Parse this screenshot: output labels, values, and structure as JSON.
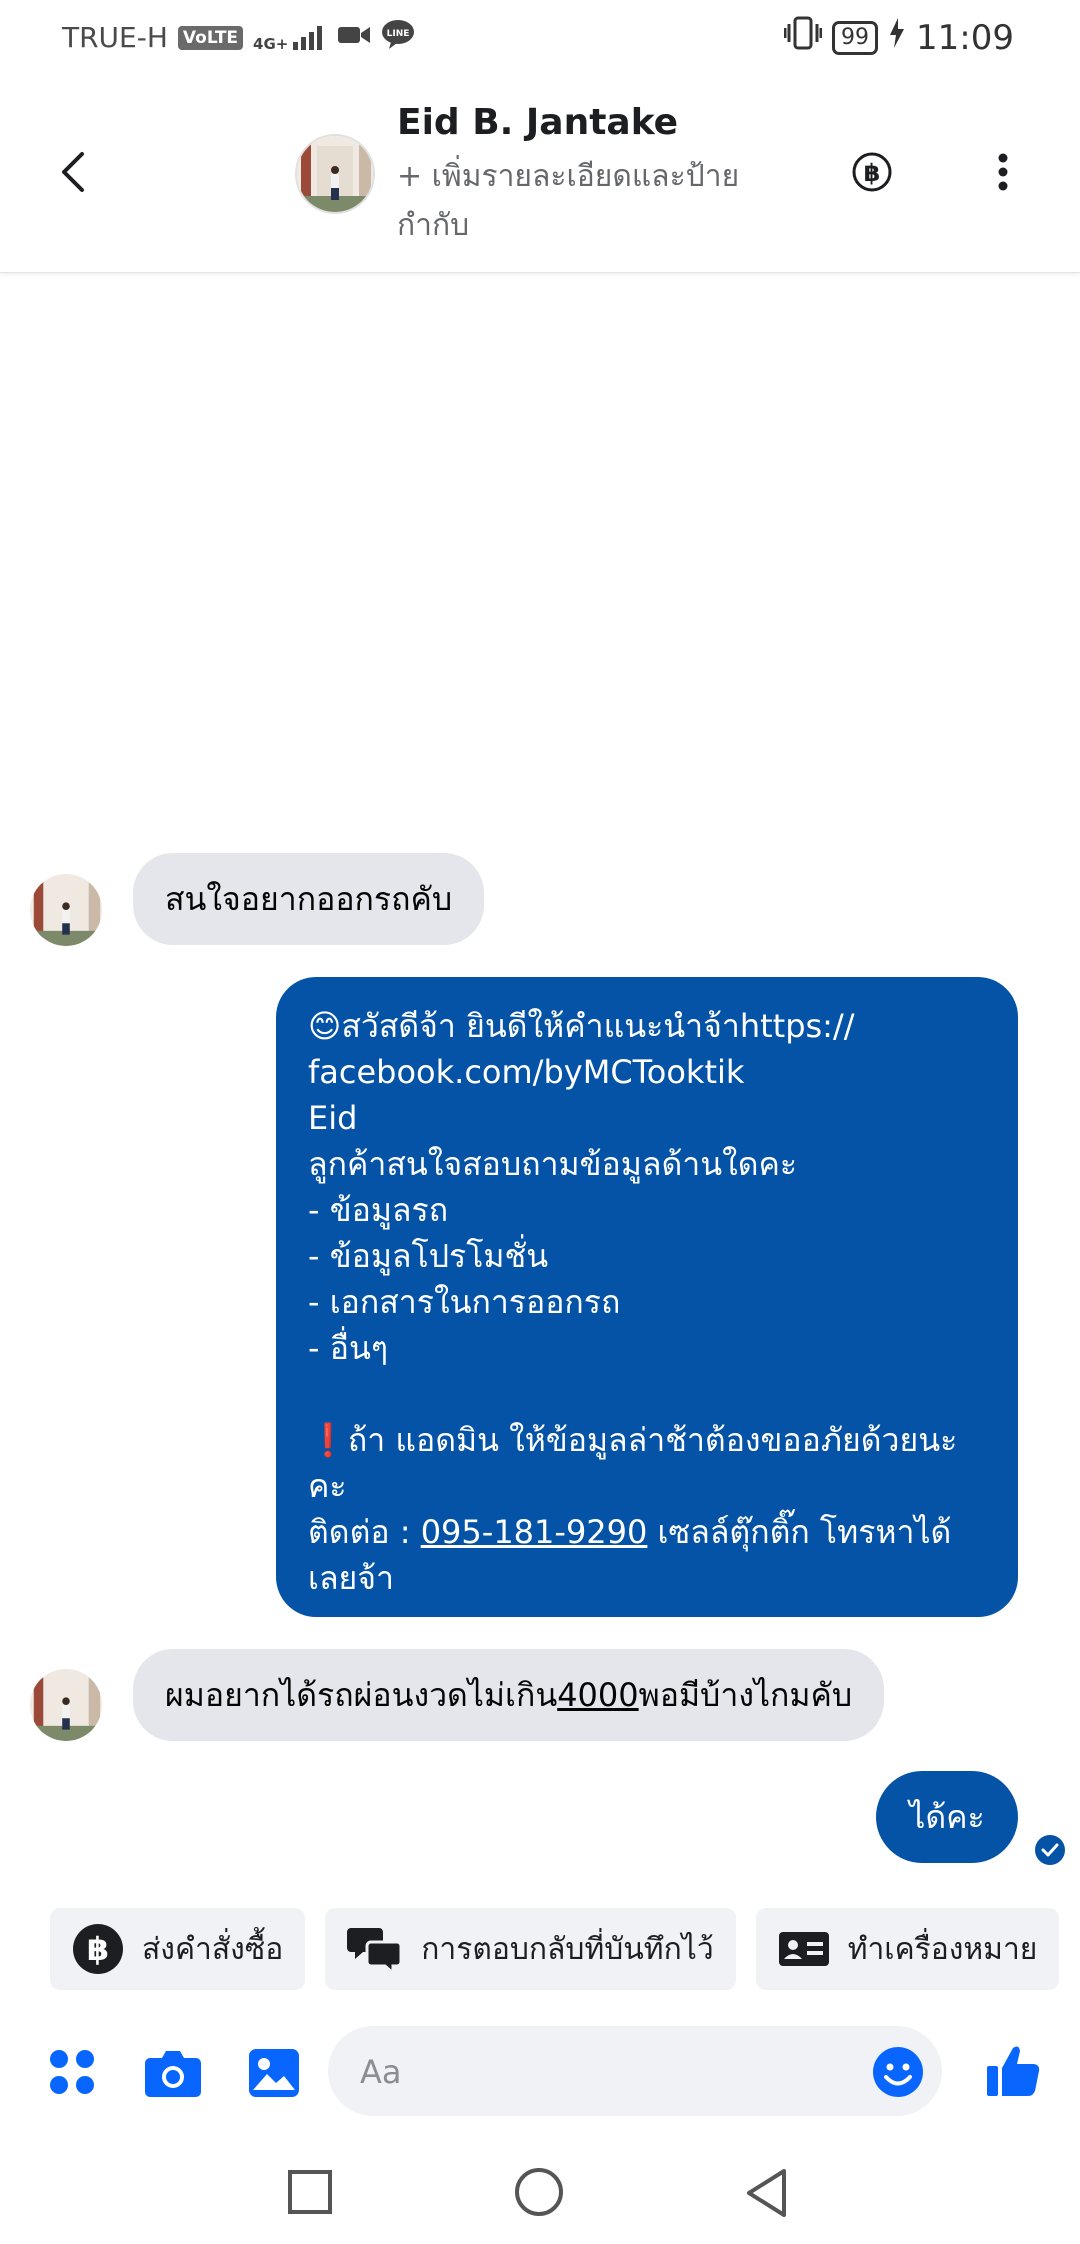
{
  "status_bar": {
    "carrier": "TRUE-H",
    "volte": "VoLTE",
    "network": "4G+",
    "battery": "99",
    "time": "11:09"
  },
  "header": {
    "name": "Eid B. Jantake",
    "subtitle": "+ เพิ่มรายละเอียดและป้ายกำกับ"
  },
  "messages": [
    {
      "direction": "in",
      "text": "สนใจอยากออกรถคับ"
    },
    {
      "direction": "out",
      "lines": [
        "😊สวัสดีจ้า ยินดีให้คำแนะนำจ้าhttps://",
        "facebook.com/byMCTooktik",
        "Eid",
        "ลูกค้าสนใจสอบถามข้อมูลด้านใดคะ",
        "- ข้อมูลรถ",
        "- ข้อมูลโปรโมชั่น",
        "- เอกสารในการออกรถ",
        "- อื่นๆ",
        "",
        "❗ถ้า แอดมิน ให้ข้อมูลล่าช้าต้องขออภัยด้วยนะ",
        "คะ"
      ],
      "contact_prefix": "ติดต่อ : ",
      "phone": "095-181-9290",
      "contact_suffix": " เซลล์ตุ๊กติ๊ก โทรหาได้",
      "last_line": "เลยจ้า"
    },
    {
      "direction": "in",
      "text_prefix": "ผมอยากได้รถผ่อนงวดไม่เกิน",
      "amount": "4000",
      "text_suffix": "พอมีบ้างไกมคับ"
    },
    {
      "direction": "out",
      "text": "ได้คะ"
    }
  ],
  "quick_replies": [
    {
      "label": "ส่งคำสั่งซื้อ",
      "icon": "baht-icon"
    },
    {
      "label": "การตอบกลับที่บันทึกไว้",
      "icon": "chat-bubbles-icon"
    },
    {
      "label": "ทำเครื่องหมาย",
      "icon": "contact-card-icon"
    }
  ],
  "composer": {
    "placeholder": "Aa"
  },
  "colors": {
    "accent": "#0866ff",
    "outgoing_bubble": "#0553a6",
    "incoming_bubble": "#e4e6eb"
  }
}
